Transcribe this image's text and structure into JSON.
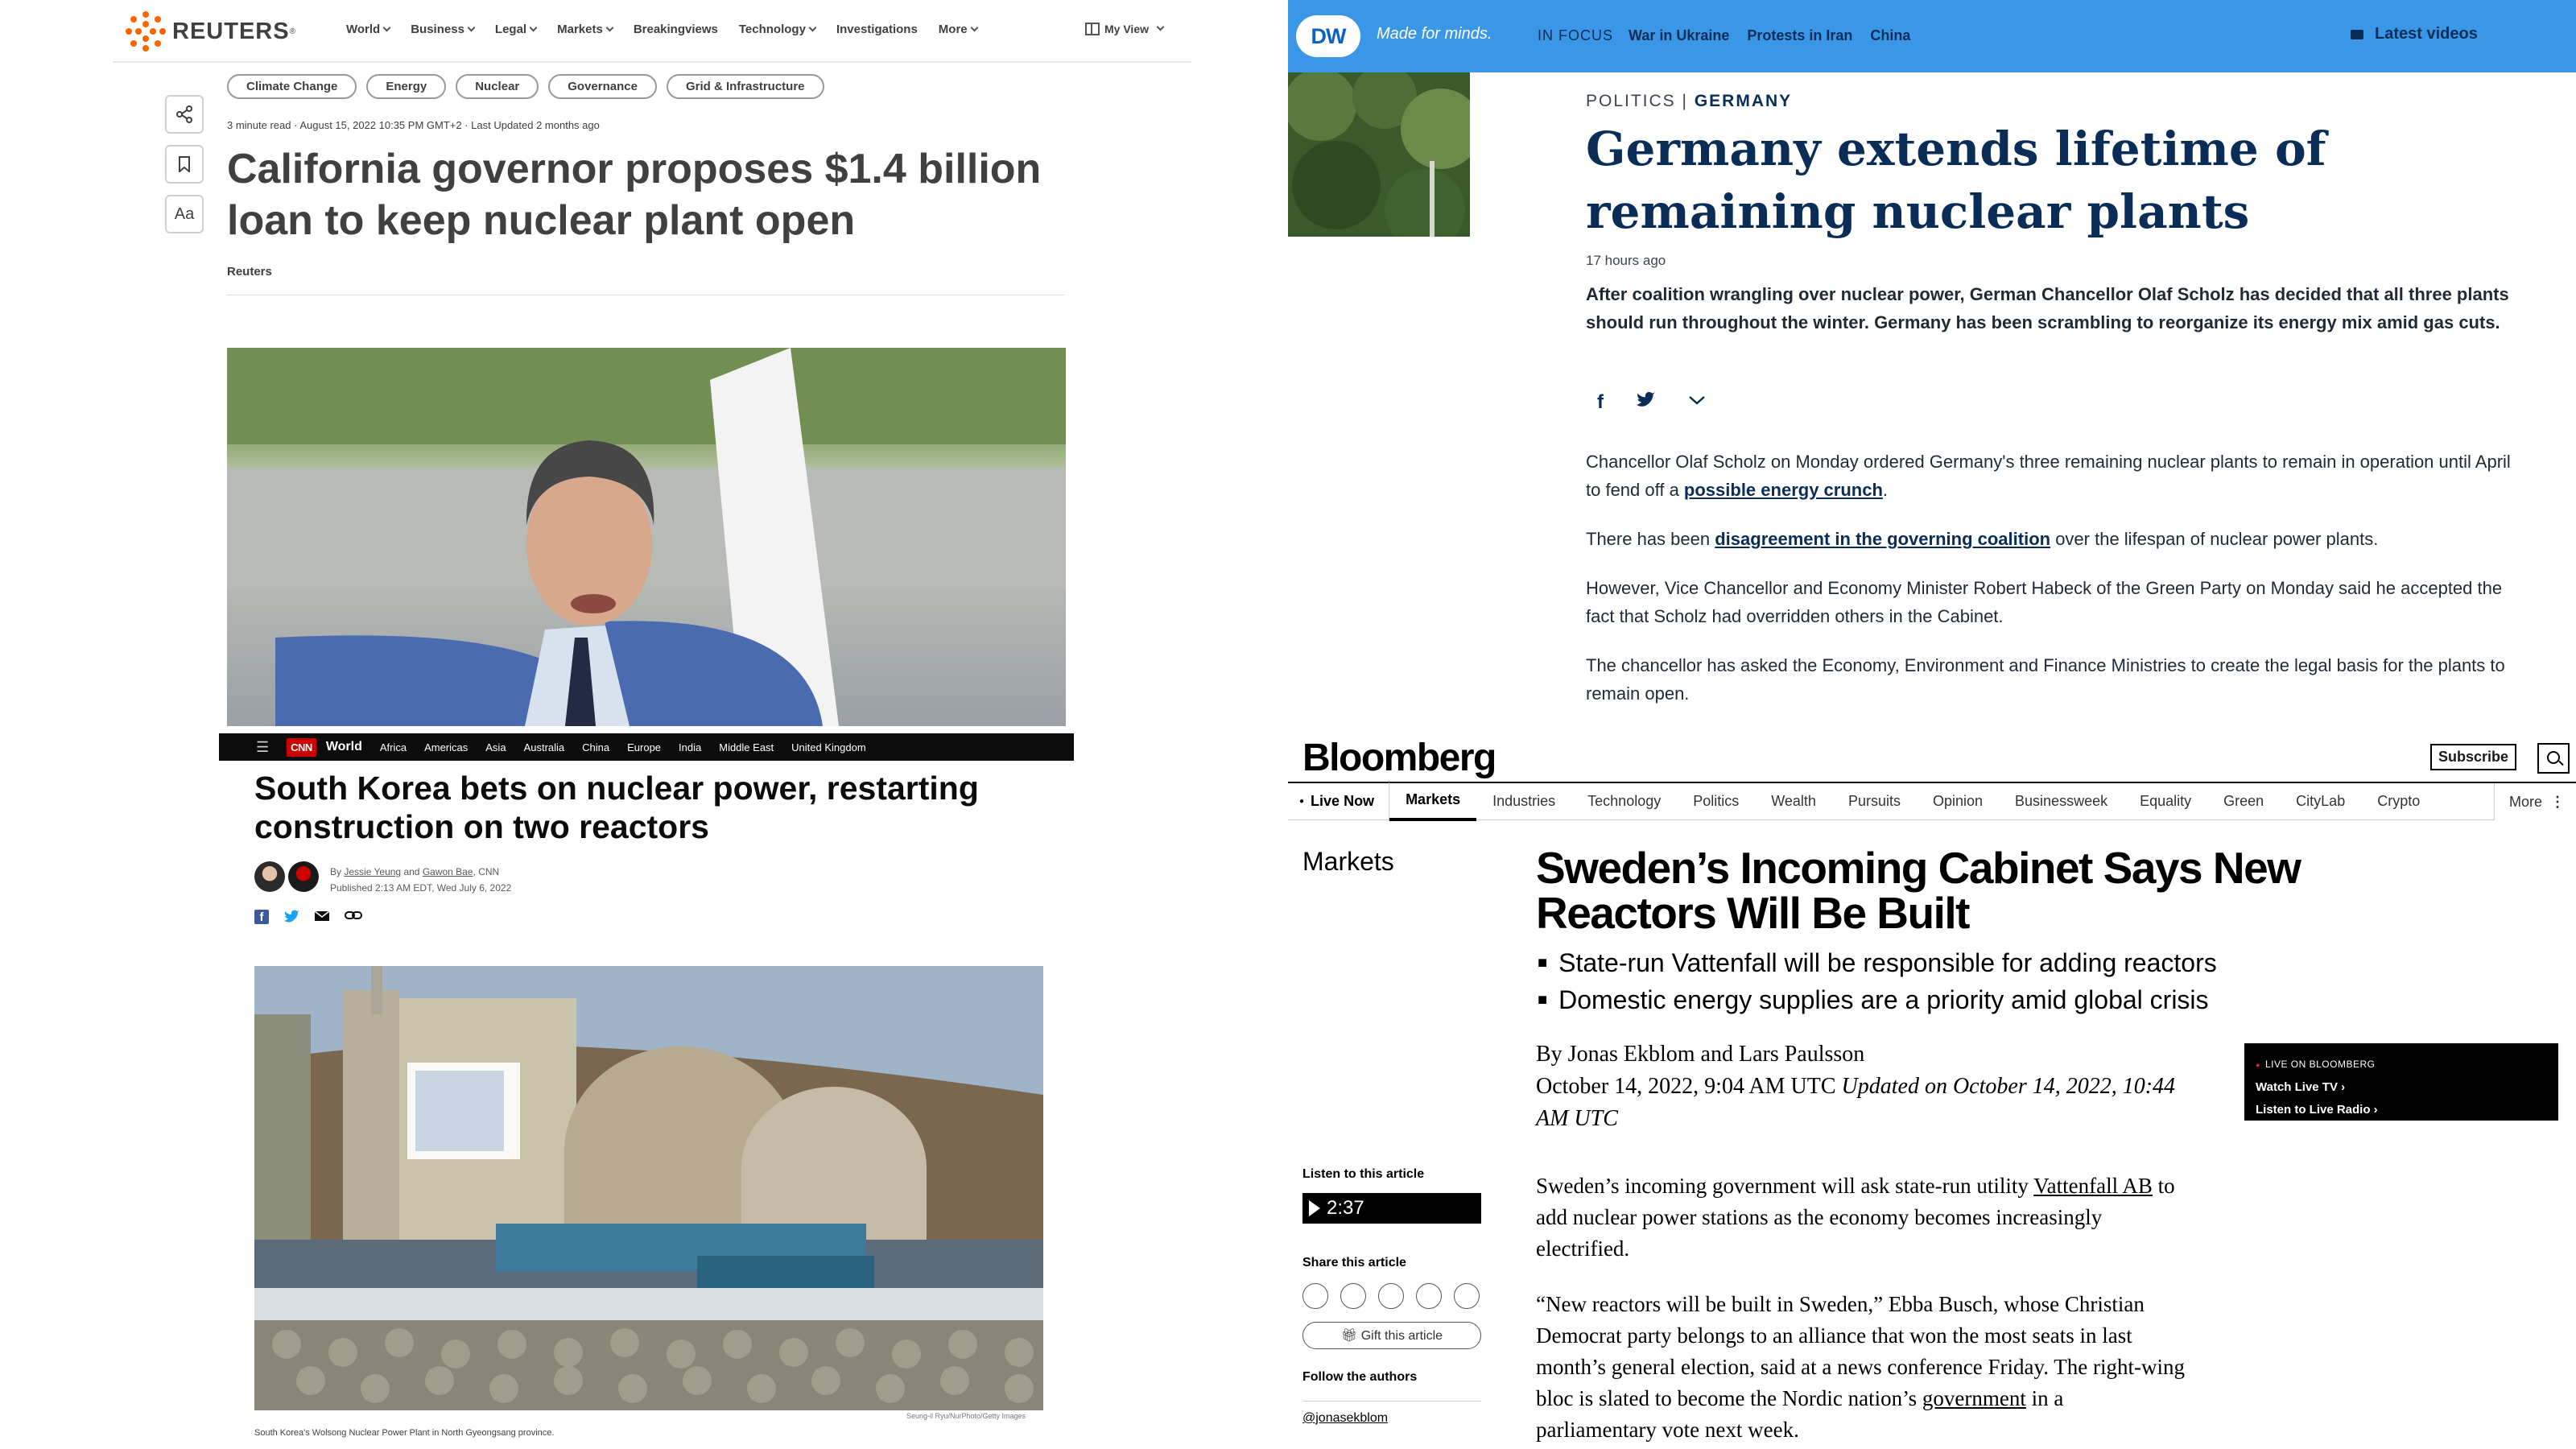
{
  "reuters": {
    "brand": "REUTERS",
    "nav": [
      "World",
      "Business",
      "Legal",
      "Markets",
      "Breakingviews",
      "Technology",
      "Investigations",
      "More"
    ],
    "my_view": "My View",
    "chips": [
      "Climate Change",
      "Energy",
      "Nuclear",
      "Governance",
      "Grid & Infrastructure"
    ],
    "font_button": "Aa",
    "meta": "3 minute read · August 15, 2022 10:35 PM GMT+2 · Last Updated 2 months ago",
    "headline": "California governor proposes $1.4 billion loan to keep nuclear plant open",
    "byline": "Reuters"
  },
  "cnn": {
    "logo": "CNN",
    "section": "World",
    "nav": [
      "Africa",
      "Americas",
      "Asia",
      "Australia",
      "China",
      "Europe",
      "India",
      "Middle East",
      "United Kingdom"
    ],
    "headline": "South Korea bets on nuclear power, restarting construction on two reactors",
    "by_prefix": "By",
    "author1": "Jessie Yeung",
    "and": "and",
    "author2": "Gawon Bae",
    "outlet": ", CNN",
    "published": "Published 2:13 AM EDT, Wed July 6, 2022",
    "photo_credit": "Seung-il Ryu/NurPhoto/Getty Images",
    "caption": "South Korea's Wolsong Nuclear Power Plant in North Gyeongsang province."
  },
  "dw": {
    "logo": "DW",
    "tagline": "Made for minds.",
    "in_focus": "IN FOCUS",
    "topics": [
      "War in Ukraine",
      "Protests in Iran",
      "China"
    ],
    "latest_videos": "Latest videos",
    "kicker_section": "POLITICS",
    "kicker_sep": " | ",
    "kicker_country": "GERMANY",
    "headline": "Germany extends lifetime of remaining nuclear plants",
    "time": "17 hours ago",
    "lead": "After coalition wrangling over nuclear power, German Chancellor Olaf Scholz has decided that all three plants should run throughout the winter. Germany has been scrambling to reorganize its energy mix amid gas cuts.",
    "p1_a": "Chancellor Olaf Scholz on Monday ordered Germany's three remaining nuclear plants to remain in operation until April to fend off a ",
    "p1_link": "possible energy crunch",
    "p1_b": ".",
    "p2_a": "There has been ",
    "p2_link": "disagreement in the governing coalition",
    "p2_b": " over the lifespan of nuclear power plants.",
    "p3": "However, Vice Chancellor and Economy Minister Robert Habeck of the Green Party on Monday said he accepted the fact that Scholz had overridden others in the Cabinet.",
    "p4": "The chancellor has asked the Economy, Environment and Finance Ministries to create the legal basis for the plants to remain open."
  },
  "bloomberg": {
    "logo": "Bloomberg",
    "subscribe": "Subscribe",
    "live_now": "Live Now",
    "nav": [
      "Markets",
      "Industries",
      "Technology",
      "Politics",
      "Wealth",
      "Pursuits",
      "Opinion",
      "Businessweek",
      "Equality",
      "Green",
      "CityLab",
      "Crypto"
    ],
    "more": "More",
    "section": "Markets",
    "headline": "Sweden’s Incoming Cabinet Says New Reactors Will Be Built",
    "bullets": [
      "State-run Vattenfall will be responsible for adding reactors",
      "Domestic energy supplies are a priority amid global crisis"
    ],
    "byline": "By Jonas Ekblom and Lars Paulsson",
    "dateline": "October 14, 2022, 9:04 AM UTC",
    "updated": "Updated on October 14, 2022, 10:44 AM UTC",
    "live_label": "LIVE ON BLOOMBERG",
    "watch_tv": "Watch Live TV",
    "listen_radio": "Listen to Live Radio",
    "listen_label": "Listen to this article",
    "duration": "2:37",
    "share_label": "Share this article",
    "gift": "Gift this article",
    "follow_label": "Follow the authors",
    "handle": "@jonasekblom",
    "p1_a": "Sweden’s incoming government will ask state-run utility ",
    "p1_link": "Vattenfall AB",
    "p1_b": " to add nuclear power stations as the economy becomes increasingly electrified.",
    "p2_a": "“New reactors will be built in Sweden,” Ebba Busch, whose Christian Democrat party belongs to an alliance that won the most seats in last month’s general election, said at a news conference Friday. The right-wing bloc is slated to become the Nordic nation’s ",
    "p2_link": "government",
    "p2_b": " in a parliamentary vote next week."
  }
}
